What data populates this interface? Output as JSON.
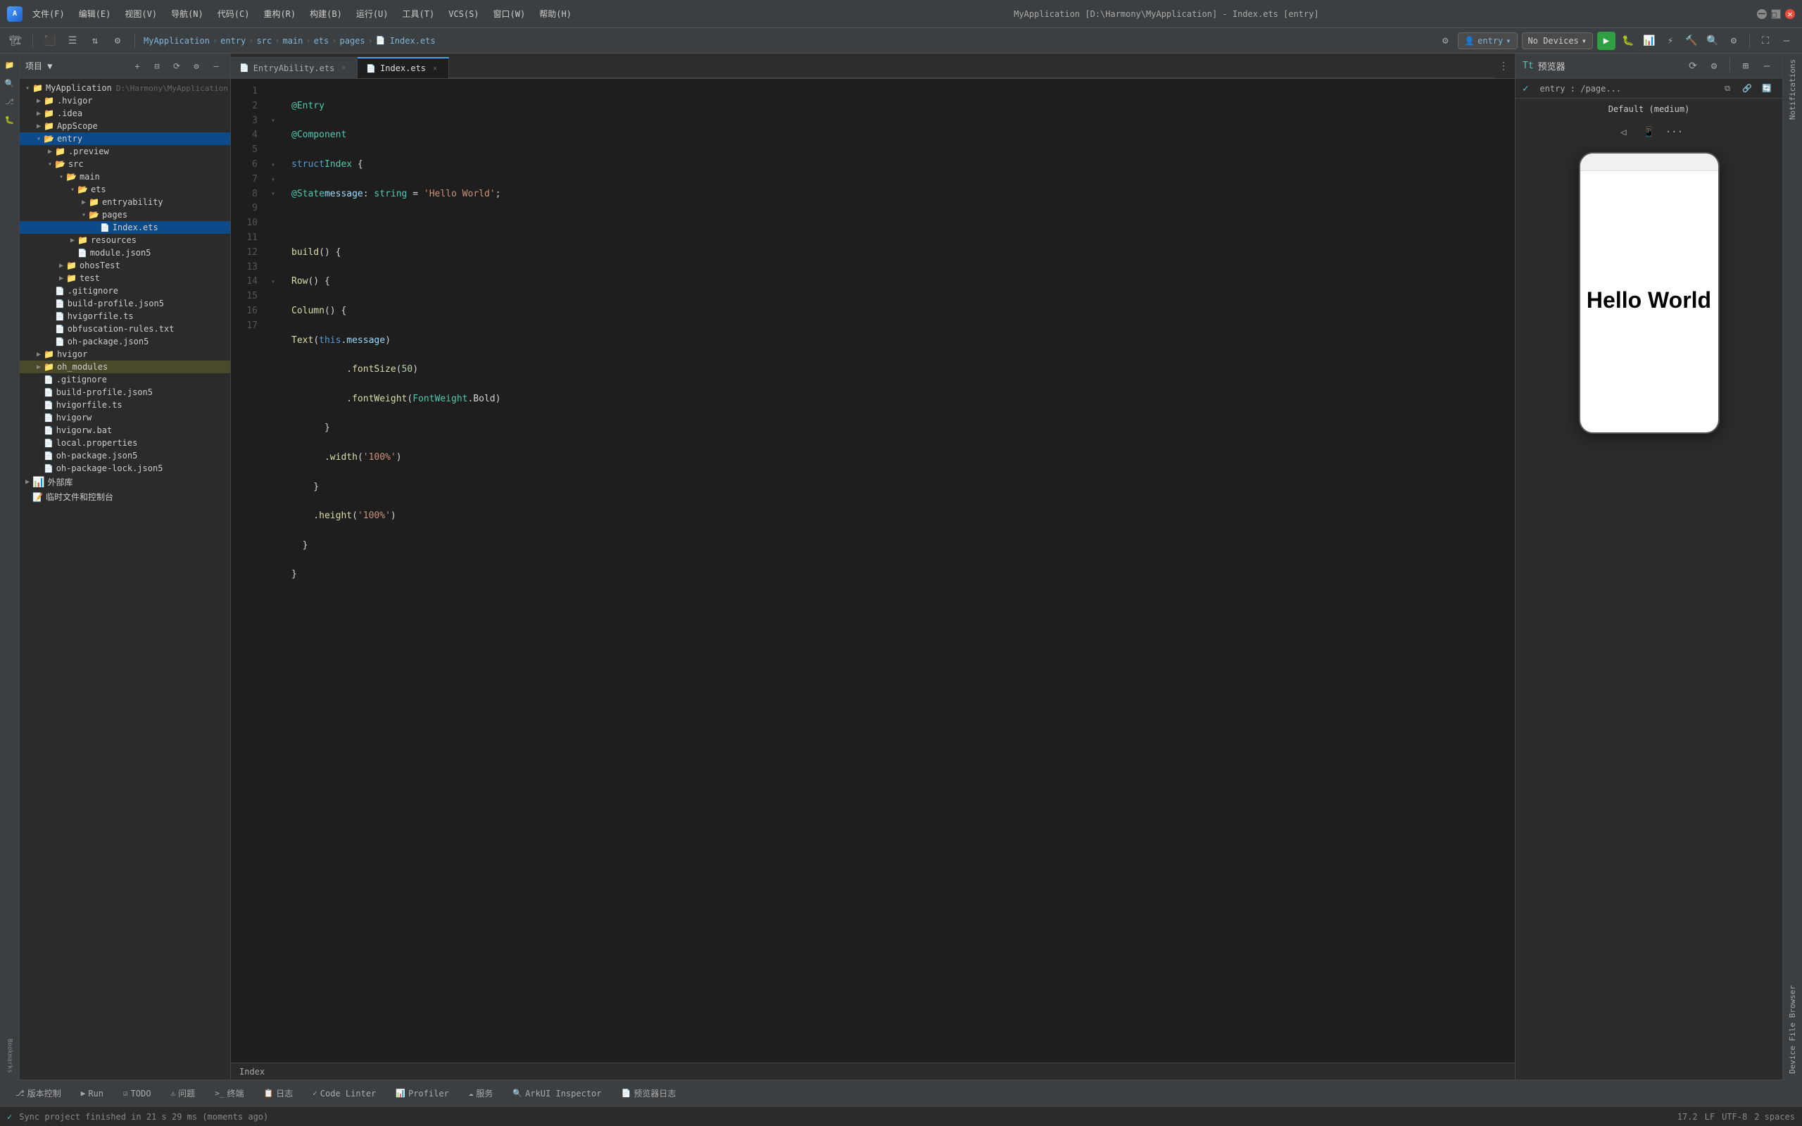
{
  "window": {
    "title": "MyApplication [D:\\Harmony\\MyApplication] - Index.ets [entry]",
    "app_name": "MyApplication"
  },
  "title_bar": {
    "logo": "A",
    "menus": [
      "文件(F)",
      "编辑(E)",
      "视图(V)",
      "导航(N)",
      "代码(C)",
      "重构(R)",
      "构建(B)",
      "运行(U)",
      "工具(T)",
      "VCS(S)",
      "窗口(W)",
      "帮助(H)"
    ],
    "title": "MyApplication [D:\\Harmony\\MyApplication] - Index.ets [entry]",
    "minimize": "─",
    "maximize": "□",
    "close": "✕"
  },
  "nav_bar": {
    "app": "MyApplication",
    "sep1": "›",
    "entry": "entry",
    "sep2": "›",
    "src": "src",
    "sep3": "›",
    "main": "main",
    "sep4": "›",
    "ets": "ets",
    "sep5": "›",
    "pages": "pages",
    "sep6": "›",
    "file": "Index.ets",
    "file_icon": "📄",
    "gear_icon": "⚙",
    "entry_btn": "entry",
    "entry_icon": "👤",
    "no_devices": "No Devices",
    "run_icon": "▶",
    "settings_icon": "⚙",
    "search_icon": "🔍"
  },
  "sidebar": {
    "header": "项目 ▼",
    "items": [
      {
        "id": "myapp",
        "label": "MyApplication",
        "sub": "D:\\Harmony\\MyApplication",
        "level": 0,
        "type": "root",
        "open": true
      },
      {
        "id": "hvigor",
        "label": ".hvigor",
        "level": 1,
        "type": "folder",
        "open": false
      },
      {
        "id": "idea",
        "label": ".idea",
        "level": 1,
        "type": "folder",
        "open": false
      },
      {
        "id": "appscope",
        "label": "AppScope",
        "level": 1,
        "type": "folder",
        "open": false
      },
      {
        "id": "entry",
        "label": "entry",
        "level": 1,
        "type": "folder",
        "open": true,
        "selected": true
      },
      {
        "id": "preview",
        "label": ".preview",
        "level": 2,
        "type": "folder",
        "open": false
      },
      {
        "id": "src",
        "label": "src",
        "level": 2,
        "type": "folder",
        "open": true
      },
      {
        "id": "main",
        "label": "main",
        "level": 3,
        "type": "folder",
        "open": true
      },
      {
        "id": "ets",
        "label": "ets",
        "level": 4,
        "type": "folder",
        "open": true
      },
      {
        "id": "entryability",
        "label": "entryability",
        "level": 5,
        "type": "folder",
        "open": false
      },
      {
        "id": "pages",
        "label": "pages",
        "level": 5,
        "type": "folder",
        "open": true
      },
      {
        "id": "indexets",
        "label": "Index.ets",
        "level": 6,
        "type": "ets",
        "open": false,
        "selected": true
      },
      {
        "id": "resources",
        "label": "resources",
        "level": 4,
        "type": "folder",
        "open": false
      },
      {
        "id": "modulejson5",
        "label": "module.json5",
        "level": 4,
        "type": "json"
      },
      {
        "id": "ohostest",
        "label": "ohosTest",
        "level": 3,
        "type": "folder",
        "open": false
      },
      {
        "id": "test",
        "label": "test",
        "level": 3,
        "type": "folder",
        "open": false
      },
      {
        "id": "gitignore",
        "label": ".gitignore",
        "level": 2,
        "type": "other"
      },
      {
        "id": "buildprofile",
        "label": "build-profile.json5",
        "level": 2,
        "type": "json"
      },
      {
        "id": "hvigorfile",
        "label": "hvigorfile.ts",
        "level": 2,
        "type": "ts"
      },
      {
        "id": "obfuscation",
        "label": "obfuscation-rules.txt",
        "level": 2,
        "type": "other"
      },
      {
        "id": "ohpackage",
        "label": "oh-package.json5",
        "level": 2,
        "type": "json"
      },
      {
        "id": "hvigor2",
        "label": "hvigor",
        "level": 1,
        "type": "folder",
        "open": false
      },
      {
        "id": "oh_modules",
        "label": "oh_modules",
        "level": 1,
        "type": "folder",
        "open": false,
        "highlighted": true
      },
      {
        "id": "gitignore2",
        "label": ".gitignore",
        "level": 2,
        "type": "other"
      },
      {
        "id": "buildprofile2",
        "label": "build-profile.json5",
        "level": 2,
        "type": "json"
      },
      {
        "id": "hvigorfile2",
        "label": "hvigorfile.ts",
        "level": 2,
        "type": "ts"
      },
      {
        "id": "hvigorw",
        "label": "hvigorw",
        "level": 2,
        "type": "other"
      },
      {
        "id": "hvigorwbat",
        "label": "hvigorw.bat",
        "level": 2,
        "type": "other"
      },
      {
        "id": "localprops",
        "label": "local.properties",
        "level": 2,
        "type": "other"
      },
      {
        "id": "ohpackage2",
        "label": "oh-package.json5",
        "level": 2,
        "type": "json"
      },
      {
        "id": "ohpackagelock",
        "label": "oh-package-lock.json5",
        "level": 2,
        "type": "json"
      },
      {
        "id": "external",
        "label": "外部库",
        "level": 1,
        "type": "folder",
        "open": false
      },
      {
        "id": "scratch",
        "label": "临时文件和控制台",
        "level": 1,
        "type": "other"
      }
    ]
  },
  "editor": {
    "tabs": [
      {
        "id": "entryability",
        "label": "EntryAbility.ets",
        "active": false,
        "modified": false
      },
      {
        "id": "indexets",
        "label": "Index.ets",
        "active": true,
        "modified": false
      }
    ],
    "cursor_line": "17.2",
    "encoding": "UTF-8",
    "indent": "2 spaces",
    "lines": [
      {
        "num": 1,
        "content": "@Entry",
        "tokens": [
          {
            "text": "@Entry",
            "cls": "dec"
          }
        ]
      },
      {
        "num": 2,
        "content": "@Component",
        "tokens": [
          {
            "text": "@Component",
            "cls": "dec"
          }
        ]
      },
      {
        "num": 3,
        "content": "struct Index {",
        "tokens": [
          {
            "text": "struct",
            "cls": "kw"
          },
          {
            "text": " Index ",
            "cls": ""
          },
          {
            "text": "{",
            "cls": ""
          }
        ]
      },
      {
        "num": 4,
        "content": "  @State message: string = 'Hello World';",
        "tokens": [
          {
            "text": "  ",
            "cls": ""
          },
          {
            "text": "@State",
            "cls": "dec"
          },
          {
            "text": " ",
            "cls": ""
          },
          {
            "text": "message",
            "cls": "prop"
          },
          {
            "text": ": ",
            "cls": ""
          },
          {
            "text": "string",
            "cls": "type"
          },
          {
            "text": " = ",
            "cls": ""
          },
          {
            "text": "'Hello World'",
            "cls": "str"
          },
          {
            "text": ";",
            "cls": ""
          }
        ]
      },
      {
        "num": 5,
        "content": "",
        "tokens": []
      },
      {
        "num": 6,
        "content": "  build() {",
        "tokens": [
          {
            "text": "  ",
            "cls": ""
          },
          {
            "text": "build",
            "cls": "fn"
          },
          {
            "text": "() {",
            "cls": ""
          }
        ]
      },
      {
        "num": 7,
        "content": "    Row() {",
        "tokens": [
          {
            "text": "    ",
            "cls": ""
          },
          {
            "text": "Row",
            "cls": "fn"
          },
          {
            "text": "() {",
            "cls": ""
          }
        ]
      },
      {
        "num": 8,
        "content": "      Column() {",
        "tokens": [
          {
            "text": "      ",
            "cls": ""
          },
          {
            "text": "Column",
            "cls": "fn"
          },
          {
            "text": "() {",
            "cls": ""
          }
        ]
      },
      {
        "num": 9,
        "content": "        Text(this.message)",
        "tokens": [
          {
            "text": "        ",
            "cls": ""
          },
          {
            "text": "Text",
            "cls": "fn"
          },
          {
            "text": "(",
            "cls": ""
          },
          {
            "text": "this",
            "cls": "kw"
          },
          {
            "text": ".",
            "cls": ""
          },
          {
            "text": "message",
            "cls": "prop"
          },
          {
            "text": ")",
            "cls": ""
          }
        ]
      },
      {
        "num": 10,
        "content": "          .fontSize(50)",
        "tokens": [
          {
            "text": "          .",
            "cls": ""
          },
          {
            "text": "fontSize",
            "cls": "fn"
          },
          {
            "text": "(",
            "cls": ""
          },
          {
            "text": "50",
            "cls": "num"
          },
          {
            "text": ")",
            "cls": ""
          }
        ]
      },
      {
        "num": 11,
        "content": "          .fontWeight(FontWeight.Bold)",
        "tokens": [
          {
            "text": "          .",
            "cls": ""
          },
          {
            "text": "fontWeight",
            "cls": "fn"
          },
          {
            "text": "(",
            "cls": ""
          },
          {
            "text": "FontWeight",
            "cls": "type"
          },
          {
            "text": ".Bold)",
            "cls": ""
          }
        ]
      },
      {
        "num": 12,
        "content": "      }",
        "tokens": [
          {
            "text": "      }",
            "cls": ""
          }
        ]
      },
      {
        "num": 13,
        "content": "      .width('100%')",
        "tokens": [
          {
            "text": "      .",
            "cls": ""
          },
          {
            "text": "width",
            "cls": "fn"
          },
          {
            "text": "('",
            "cls": ""
          },
          {
            "text": "100%",
            "cls": "str"
          },
          {
            "text": "')",
            "cls": ""
          }
        ]
      },
      {
        "num": 14,
        "content": "    }",
        "tokens": [
          {
            "text": "    }",
            "cls": ""
          }
        ]
      },
      {
        "num": 15,
        "content": "    .height('100%')",
        "tokens": [
          {
            "text": "    .",
            "cls": ""
          },
          {
            "text": "height",
            "cls": "fn"
          },
          {
            "text": "('",
            "cls": ""
          },
          {
            "text": "100%",
            "cls": "str"
          },
          {
            "text": "')",
            "cls": ""
          }
        ]
      },
      {
        "num": 16,
        "content": "  }",
        "tokens": [
          {
            "text": "  }",
            "cls": ""
          }
        ]
      },
      {
        "num": 17,
        "content": "}",
        "tokens": [
          {
            "text": "}",
            "cls": ""
          }
        ]
      }
    ]
  },
  "preview": {
    "header_title": "预览器",
    "route": "entry : /page...",
    "device_label": "Default (medium)",
    "hello_world": "Hello World",
    "toolbar_icons": [
      "←",
      "📱",
      "···"
    ]
  },
  "status_tabs": [
    {
      "id": "version",
      "label": "版本控制",
      "icon": "⎇",
      "active": false
    },
    {
      "id": "run",
      "label": "Run",
      "icon": "▶",
      "active": false
    },
    {
      "id": "todo",
      "label": "TODO",
      "icon": "☑",
      "active": false
    },
    {
      "id": "problems",
      "label": "问题",
      "icon": "⚠",
      "active": false
    },
    {
      "id": "terminal",
      "label": "终端",
      "icon": ">_",
      "active": false
    },
    {
      "id": "log",
      "label": "日志",
      "icon": "📋",
      "active": false
    },
    {
      "id": "linter",
      "label": "Code Linter",
      "icon": "✓",
      "active": false
    },
    {
      "id": "profiler",
      "label": "Profiler",
      "icon": "📊",
      "active": false
    },
    {
      "id": "service",
      "label": "服务",
      "icon": "☁",
      "active": false
    },
    {
      "id": "arkui",
      "label": "ArkUI Inspector",
      "icon": "🔍",
      "active": false
    },
    {
      "id": "preview_log",
      "label": "预览器日志",
      "icon": "📄",
      "active": false
    }
  ],
  "bottom_status": {
    "ok_icon": "✓",
    "message": "Sync project finished in 21 s 29 ms (moments ago)",
    "cursor": "17.2",
    "lf": "LF",
    "encoding": "UTF-8",
    "indent": "2 spaces"
  },
  "right_panel_labels": [
    "Notifications",
    "Device File Browser"
  ],
  "index_label": "Index"
}
